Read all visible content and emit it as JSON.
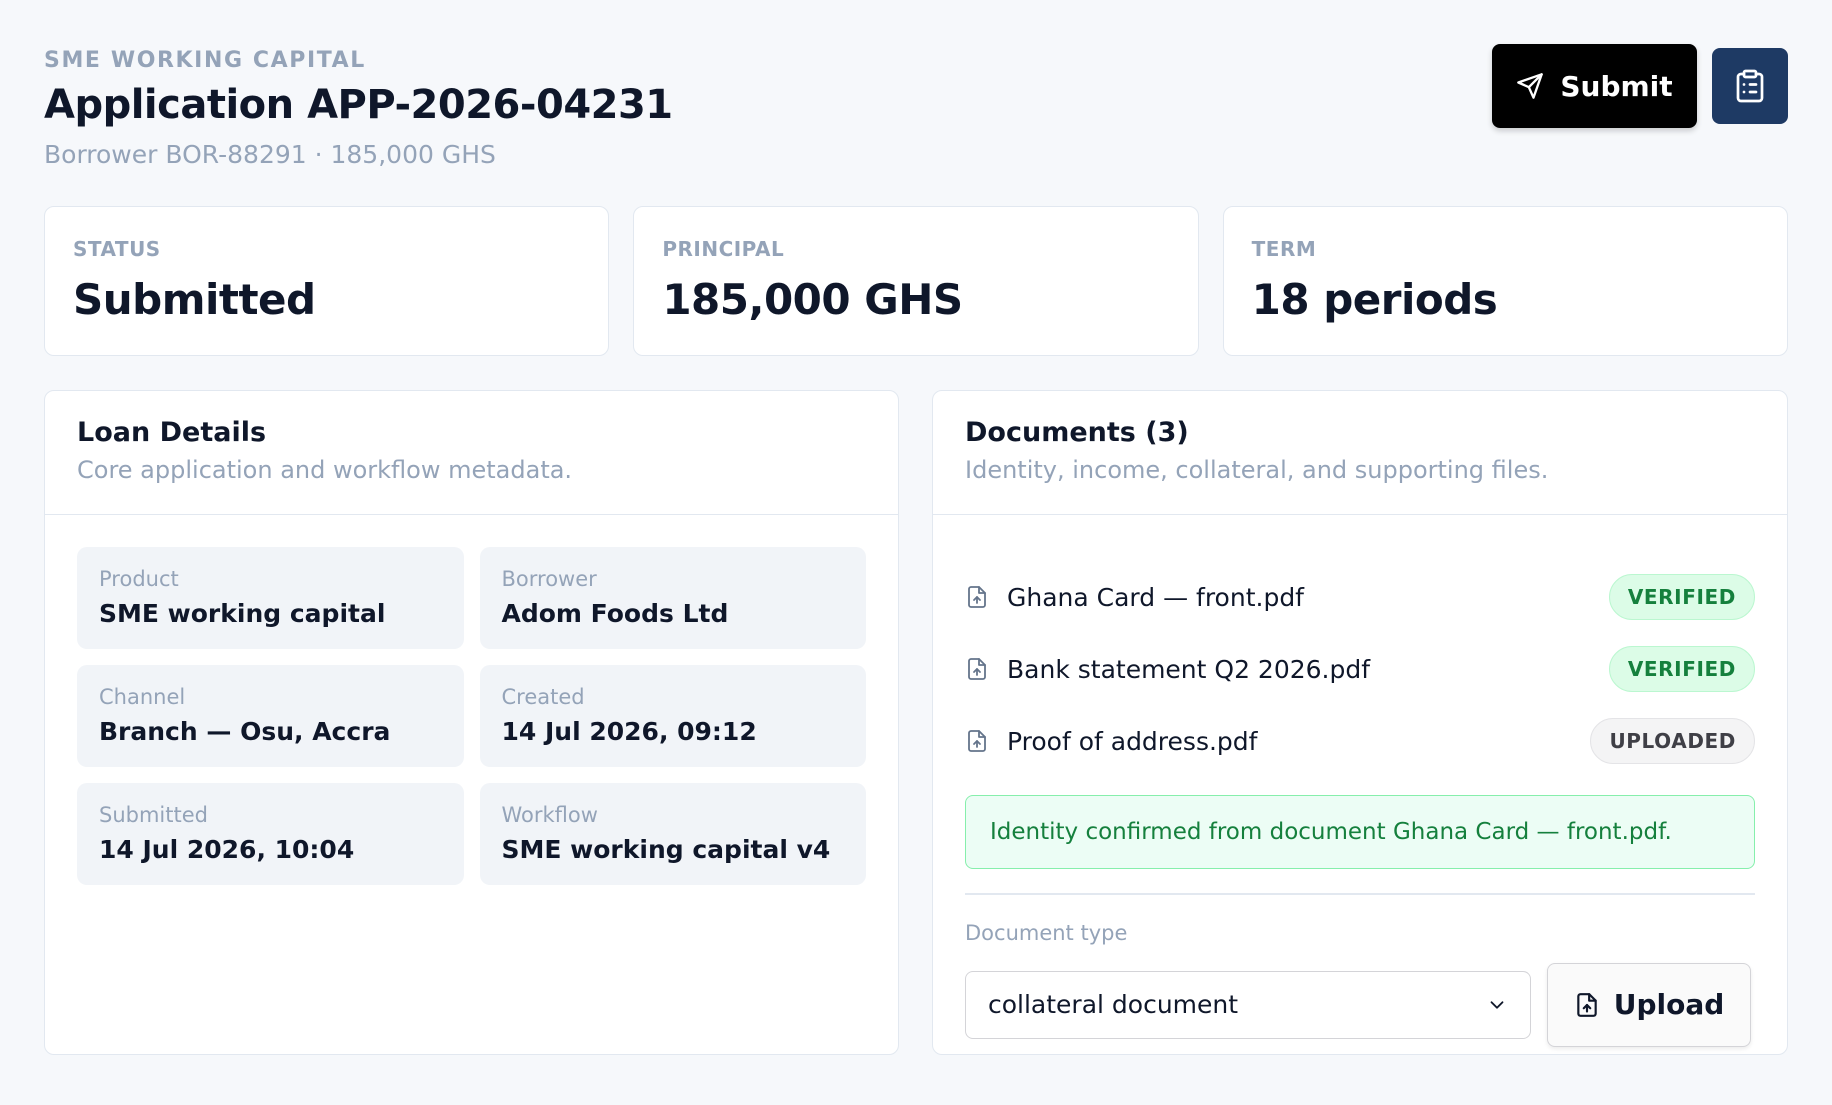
{
  "header": {
    "eyebrow": "SME WORKING CAPITAL",
    "title": "Application APP-2026-04231",
    "subtitle": "Borrower BOR-88291 · 185,000 GHS",
    "submit_label": "Submit",
    "submit_icon": "send-icon",
    "clipboard_icon": "clipboard-list-icon"
  },
  "stats": [
    {
      "label": "STATUS",
      "value": "Submitted"
    },
    {
      "label": "PRINCIPAL",
      "value": "185,000 GHS"
    },
    {
      "label": "TERM",
      "value": "18 periods"
    }
  ],
  "loan_details": {
    "title": "Loan Details",
    "description": "Core application and workflow metadata.",
    "fields": [
      {
        "label": "Product",
        "value": "SME working capital"
      },
      {
        "label": "Borrower",
        "value": "Adom Foods Ltd"
      },
      {
        "label": "Channel",
        "value": "Branch — Osu, Accra"
      },
      {
        "label": "Created",
        "value": "14 Jul 2026, 09:12"
      },
      {
        "label": "Submitted",
        "value": "14 Jul 2026, 10:04"
      },
      {
        "label": "Workflow",
        "value": "SME working capital v4"
      }
    ]
  },
  "documents": {
    "title": "Documents (3)",
    "description": "Identity, income, collateral, and supporting files.",
    "items": [
      {
        "name": "Ghana Card — front.pdf",
        "status": "VERIFIED"
      },
      {
        "name": "Bank statement Q2 2026.pdf",
        "status": "VERIFIED"
      },
      {
        "name": "Proof of address.pdf",
        "status": "UPLOADED"
      }
    ],
    "notice": "Identity confirmed from document Ghana Card — front.pdf.",
    "doc_type_label": "Document type",
    "doc_type_value": "collateral document",
    "upload_label": "Upload"
  },
  "colors": {
    "primary_button": "#000000",
    "clipboard_button": "#1e3a64",
    "verified": "#15803d",
    "background": "#f6f8fb"
  }
}
